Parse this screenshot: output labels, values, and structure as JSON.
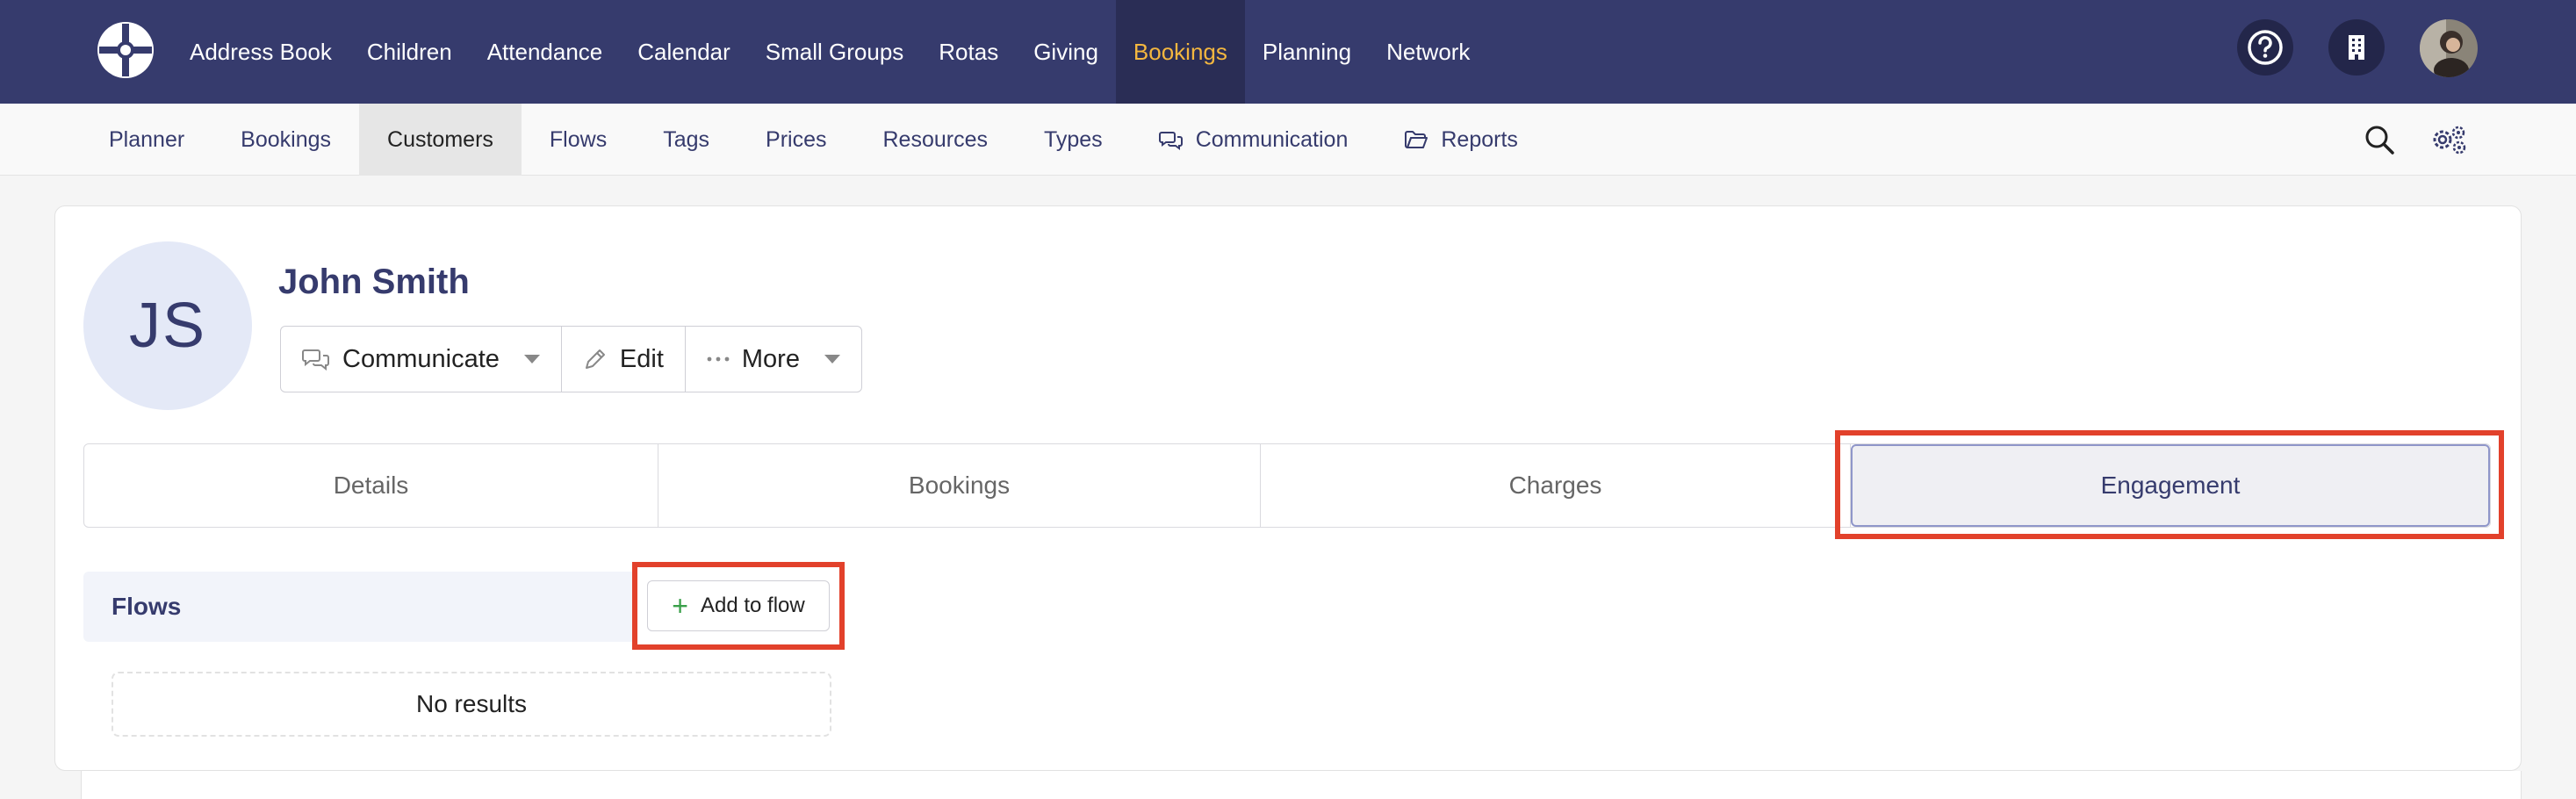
{
  "topnav": {
    "items": [
      "Address Book",
      "Children",
      "Attendance",
      "Calendar",
      "Small Groups",
      "Rotas",
      "Giving",
      "Bookings",
      "Planning",
      "Network"
    ],
    "active": "Bookings",
    "colors": {
      "background": "#363b6d",
      "active_background": "#2a2d55",
      "active_text": "#f4b73f"
    },
    "icons": [
      "help-icon",
      "building-icon",
      "user-avatar"
    ]
  },
  "subnav": {
    "items": [
      "Planner",
      "Bookings",
      "Customers",
      "Flows",
      "Tags",
      "Prices",
      "Resources",
      "Types",
      "Communication",
      "Reports"
    ],
    "active": "Customers",
    "icons": [
      "search-icon",
      "settings-gear-icon"
    ]
  },
  "profile": {
    "initials": "JS",
    "name": "John Smith",
    "actions": {
      "communicate": "Communicate",
      "edit": "Edit",
      "more": "More"
    }
  },
  "tabs": [
    "Details",
    "Bookings",
    "Charges",
    "Engagement"
  ],
  "active_tab": "Engagement",
  "flows": {
    "label": "Flows",
    "add_button": "Add to flow",
    "empty_text": "No results"
  },
  "highlight_color": "#e2412b"
}
